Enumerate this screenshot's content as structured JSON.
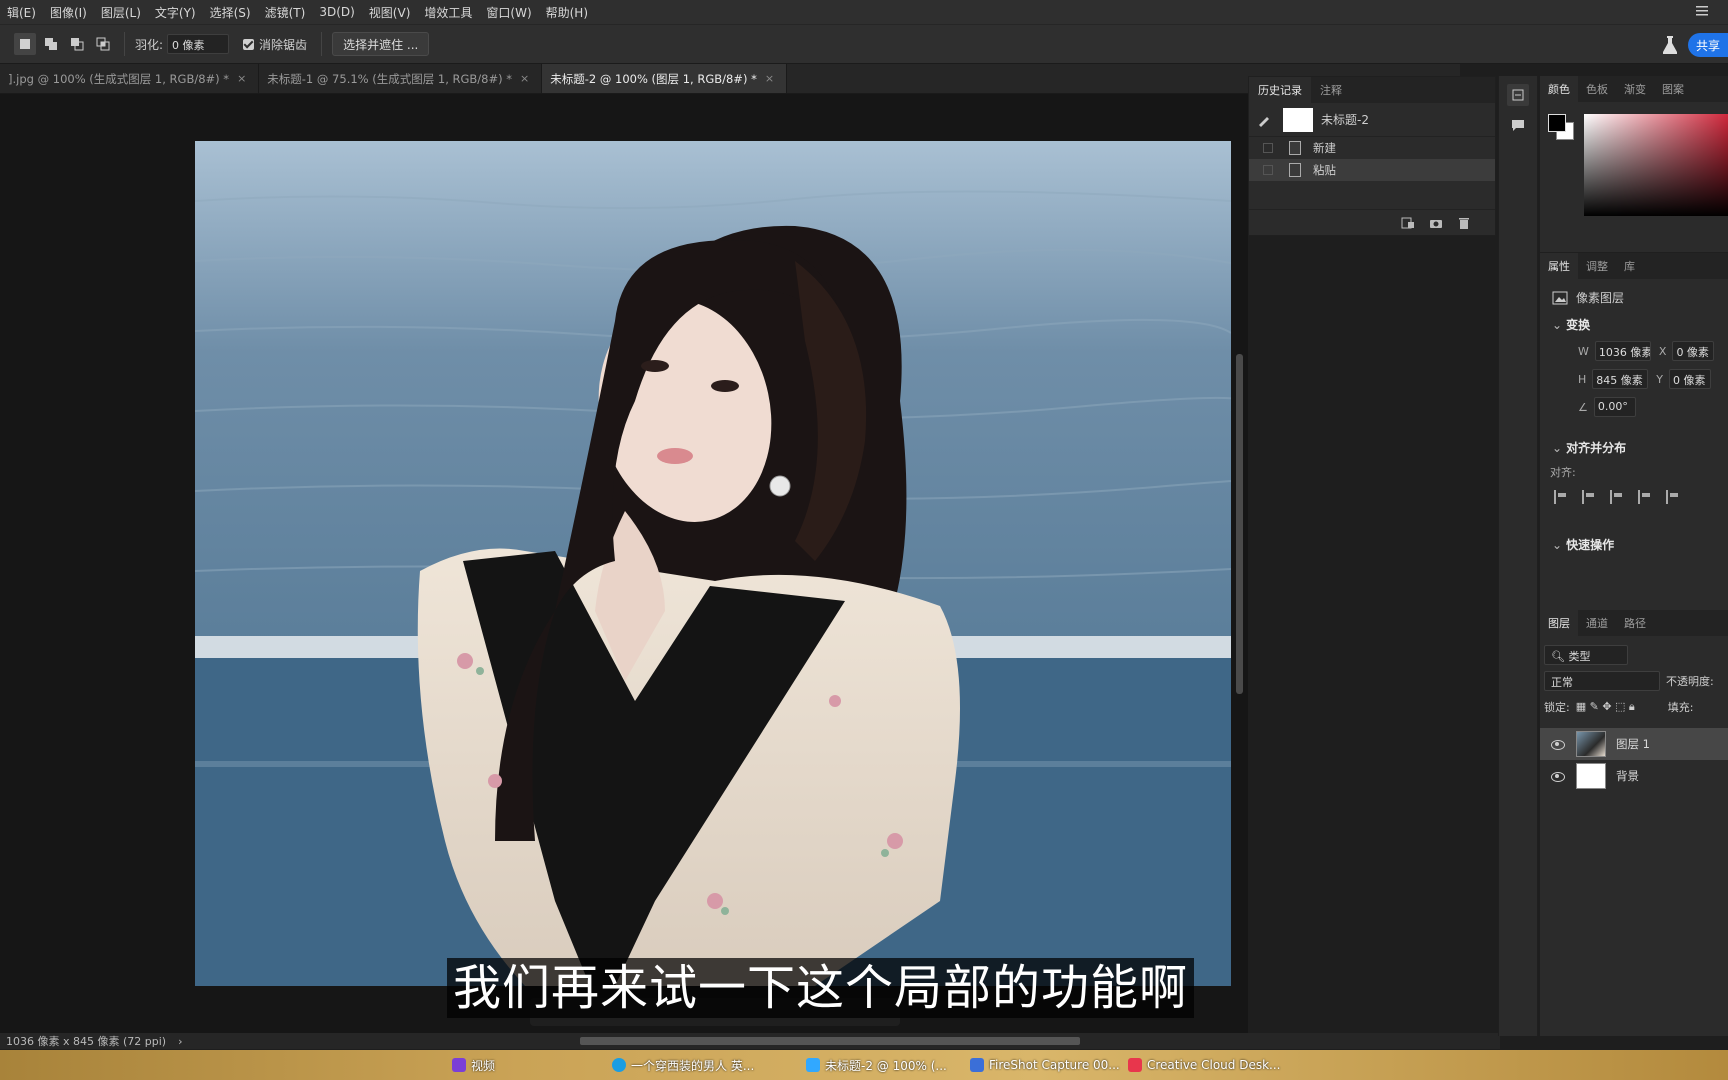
{
  "menu": [
    "辑(E)",
    "图像(I)",
    "图层(L)",
    "文字(Y)",
    "选择(S)",
    "滤镜(T)",
    "3D(D)",
    "视图(V)",
    "增效工具",
    "窗口(W)",
    "帮助(H)"
  ],
  "options": {
    "feather_label": "羽化:",
    "feather_value": "0 像素",
    "antialias_label": "消除锯齿",
    "select_mask_label": "选择并遮住 ...",
    "share_label": "共享"
  },
  "tabs": [
    {
      "label": "].jpg @ 100% (生成式图层 1, RGB/8#) *",
      "close": "×"
    },
    {
      "label": "未标题-1 @ 75.1% (生成式图层 1, RGB/8#) *",
      "close": "×"
    },
    {
      "label": "未标题-2 @ 100% (图层 1, RGB/8#) *",
      "close": "×"
    }
  ],
  "history": {
    "tab_history": "历史记录",
    "tab_notes": "注释",
    "snapshot_label": "未标题-2",
    "items": [
      "新建",
      "粘贴"
    ]
  },
  "color_panel": {
    "tabs": [
      "颜色",
      "色板",
      "渐变",
      "图案"
    ],
    "foreground": "#000000",
    "background": "#ffffff"
  },
  "properties": {
    "tabs": [
      "属性",
      "调整",
      "库"
    ],
    "layer_type": "像素图层",
    "transform_title": "变换",
    "w_label": "W",
    "w_value": "1036 像素",
    "h_label": "H",
    "h_value": "845 像素",
    "x_label": "X",
    "x_value": "0 像素",
    "y_label": "Y",
    "y_value": "0 像素",
    "angle_value": "0.00°",
    "align_title": "对齐并分布",
    "align_label": "对齐:",
    "quick_title": "快速操作"
  },
  "layers": {
    "tabs": [
      "图层",
      "通道",
      "路径"
    ],
    "filter_kind": "类型",
    "blend_mode": "正常",
    "opacity_label": "不透明度:",
    "lock_label": "锁定:",
    "fill_label": "填充:",
    "items": [
      {
        "name": "图层 1",
        "selected": true
      },
      {
        "name": "背景",
        "selected": false
      }
    ]
  },
  "status": {
    "doc_size": "1036 像素 x 845 像素 (72 ppi)",
    "arrow": "›"
  },
  "subtitle": "我们再来试一下这个局部的功能啊",
  "taskbar": {
    "items": [
      "视频",
      "一个穿西装的男人 英...",
      "未标题-2 @ 100% (...",
      "FireShot Capture 00...",
      "Creative Cloud Desk..."
    ]
  }
}
